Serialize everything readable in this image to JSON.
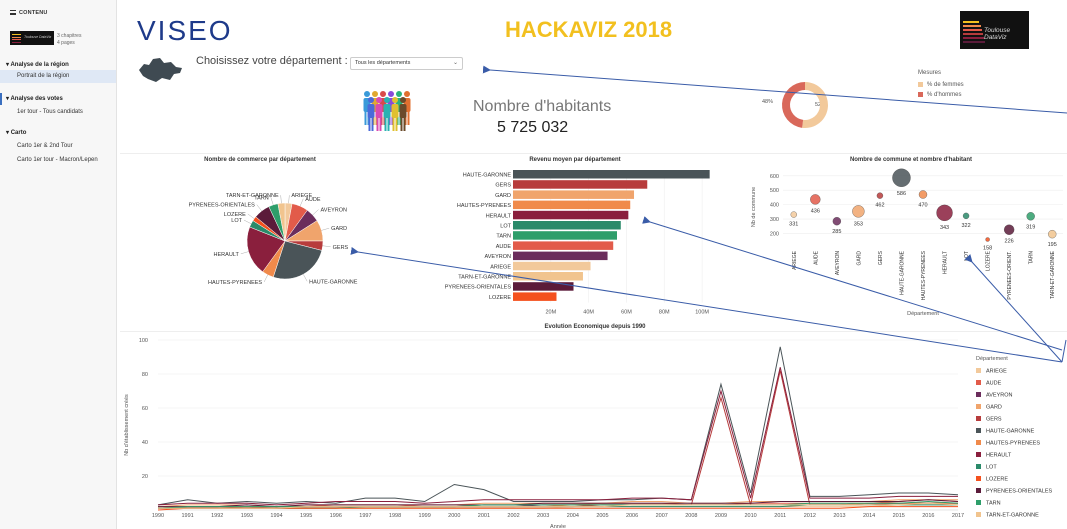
{
  "sidebar": {
    "header": "CONTENU",
    "meta_chapters": "3 chapitres",
    "meta_pages": "4 pages",
    "sections": [
      {
        "label": "Analyse de la région",
        "items": [
          "Portrait de la région"
        ]
      },
      {
        "label": "Analyse des votes",
        "items": [
          "1er tour - Tous candidats"
        ]
      },
      {
        "label": "Carto",
        "items": [
          "Carto 1er & 2nd Tour",
          "Carto 1er tour - Macron/Lepen"
        ]
      }
    ],
    "thumb_text": "Toulouse DataViz"
  },
  "header": {
    "logo": "VISEO",
    "title": "HACKAVIZ 2018",
    "brand_logo_text": "Toulouse DataViz"
  },
  "filter": {
    "label": "Choisissez votre département :",
    "selected": "Tous les départements"
  },
  "kpi": {
    "label": "Nombre d'habitants",
    "value": "5 725 032"
  },
  "colors": {
    "ARIEGE": "#f2c99b",
    "AUDE": "#e25b4a",
    "AVEYRON": "#6b2d5c",
    "GARD": "#f0a46c",
    "GERS": "#b73c3c",
    "HAUTE-GARONNE": "#4a5458",
    "HAUTES-PYRENEES": "#f08a4b",
    "HERAULT": "#8a1f3d",
    "LOT": "#2a8a6a",
    "LOZERE": "#f4511e",
    "PYRENEES-ORIENTALES": "#5b1b3a",
    "TARN": "#2e9e6a",
    "TARN-ET-GARONNE": "#f1c48e"
  },
  "chart_data": [
    {
      "type": "pie",
      "title": "Mesures",
      "legend_title": "Mesures",
      "labels": [
        "% de femmes",
        "% d'hommes"
      ],
      "values": [
        52,
        48
      ],
      "value_labels": [
        "52%",
        "48%"
      ],
      "colors": [
        "#f2c99b",
        "#d9685a"
      ]
    },
    {
      "type": "pie",
      "title": "Nombre de commerce par département",
      "labels": [
        "ARIEGE",
        "AUDE",
        "AVEYRON",
        "GARD",
        "GERS",
        "HAUTE-GARONNE",
        "HAUTES-PYRENEES",
        "HERAULT",
        "LOT",
        "LOZERE",
        "PYRENEES-ORIENTALES",
        "TARN",
        "TARN-ET-GARONNE"
      ],
      "values": [
        3,
        7,
        6,
        9,
        4,
        26,
        5,
        21,
        3,
        2,
        7,
        4,
        3
      ]
    },
    {
      "type": "bar",
      "orientation": "horizontal",
      "title": "Revenu moyen par département",
      "categories": [
        "HAUTE-GARONNE",
        "GERS",
        "GARD",
        "HAUTES-PYRENEES",
        "HERAULT",
        "LOT",
        "TARN",
        "AUDE",
        "AVEYRON",
        "ARIEGE",
        "TARN-ET-GARONNE",
        "PYRENEES-ORIENTALES",
        "LOZERE"
      ],
      "values": [
        104,
        71,
        64,
        62,
        61,
        57,
        55,
        53,
        50,
        41,
        37,
        32,
        23
      ],
      "unit": "M",
      "xticks": [
        "20M",
        "40M",
        "60M",
        "80M",
        "100M"
      ],
      "xlim": [
        0,
        110
      ]
    },
    {
      "type": "scatter",
      "title": "Nombre de commune et nombre d'habitant",
      "xlabel": "Département",
      "ylabel": "Nb de commune",
      "categories": [
        "ARIEGE",
        "AUDE",
        "AVEYRON",
        "GARD",
        "GERS",
        "HAUTE-GARONNE",
        "HAUTES-PYRENEES",
        "HERAULT",
        "LOT",
        "LOZERE",
        "PYRENEES-ORIENT.",
        "TARN",
        "TARN-ET-GARONNE"
      ],
      "values": [
        331,
        436,
        285,
        353,
        462,
        586,
        470,
        343,
        322,
        158,
        226,
        319,
        195
      ],
      "sizes": [
        3,
        5,
        4,
        6,
        3,
        9,
        4,
        8,
        3,
        2,
        5,
        4,
        4
      ],
      "yticks": [
        200,
        300,
        400,
        500,
        600
      ],
      "ylim": [
        120,
        640
      ]
    },
    {
      "type": "line",
      "title": "Evolution Economique depuis 1990",
      "xlabel": "Année",
      "ylabel": "Nb d'établissement créés",
      "legend_title": "Département",
      "x": [
        1990,
        1991,
        1992,
        1993,
        1994,
        1995,
        1996,
        1997,
        1998,
        1999,
        2000,
        2001,
        2002,
        2003,
        2004,
        2005,
        2006,
        2007,
        2008,
        2009,
        2010,
        2011,
        2012,
        2013,
        2014,
        2015,
        2016,
        2017
      ],
      "yticks": [
        20,
        40,
        60,
        80,
        100
      ],
      "ylim": [
        0,
        100
      ],
      "series": [
        {
          "name": "ARIEGE",
          "values": [
            1,
            1,
            1,
            1,
            1,
            1,
            1,
            1,
            1,
            1,
            1,
            1,
            1,
            1,
            2,
            2,
            2,
            2,
            2,
            2,
            2,
            2,
            2,
            2,
            2,
            3,
            3,
            3
          ]
        },
        {
          "name": "AUDE",
          "values": [
            2,
            2,
            2,
            2,
            2,
            2,
            3,
            3,
            3,
            2,
            2,
            3,
            3,
            3,
            3,
            4,
            4,
            4,
            3,
            3,
            4,
            4,
            4,
            4,
            4,
            5,
            6,
            5
          ]
        },
        {
          "name": "AVEYRON",
          "values": [
            1,
            2,
            2,
            2,
            2,
            2,
            2,
            2,
            2,
            2,
            2,
            2,
            2,
            3,
            3,
            3,
            3,
            3,
            3,
            3,
            3,
            3,
            3,
            3,
            4,
            4,
            4,
            4
          ]
        },
        {
          "name": "GARD",
          "values": [
            2,
            3,
            3,
            3,
            2,
            3,
            3,
            3,
            3,
            3,
            3,
            4,
            4,
            4,
            4,
            4,
            5,
            5,
            4,
            4,
            5,
            5,
            5,
            5,
            5,
            6,
            6,
            6
          ]
        },
        {
          "name": "GERS",
          "values": [
            1,
            1,
            1,
            2,
            1,
            2,
            2,
            2,
            2,
            2,
            2,
            2,
            2,
            2,
            2,
            3,
            3,
            3,
            3,
            66,
            3,
            82,
            3,
            3,
            3,
            4,
            4,
            4
          ]
        },
        {
          "name": "HAUTE-GARONNE",
          "values": [
            3,
            6,
            4,
            5,
            4,
            5,
            4,
            7,
            7,
            5,
            15,
            12,
            5,
            5,
            5,
            6,
            6,
            7,
            6,
            74,
            10,
            96,
            8,
            8,
            9,
            10,
            10,
            9
          ]
        },
        {
          "name": "HAUTES-PYRENEES",
          "values": [
            1,
            2,
            2,
            2,
            2,
            2,
            2,
            2,
            2,
            2,
            2,
            2,
            2,
            2,
            3,
            3,
            3,
            3,
            3,
            3,
            3,
            3,
            3,
            3,
            4,
            4,
            4,
            4
          ]
        },
        {
          "name": "HERAULT",
          "values": [
            3,
            4,
            4,
            4,
            3,
            4,
            5,
            5,
            5,
            4,
            5,
            6,
            6,
            6,
            6,
            6,
            7,
            7,
            6,
            70,
            7,
            84,
            7,
            7,
            7,
            8,
            8,
            8
          ]
        },
        {
          "name": "LOT",
          "values": [
            1,
            1,
            1,
            1,
            1,
            1,
            1,
            2,
            2,
            2,
            2,
            2,
            2,
            2,
            2,
            2,
            2,
            2,
            2,
            2,
            2,
            2,
            3,
            3,
            3,
            3,
            3,
            3
          ]
        },
        {
          "name": "LOZERE",
          "values": [
            0,
            1,
            1,
            1,
            1,
            1,
            1,
            1,
            1,
            1,
            1,
            1,
            1,
            1,
            1,
            1,
            1,
            1,
            1,
            1,
            1,
            1,
            1,
            1,
            2,
            2,
            2,
            2
          ]
        },
        {
          "name": "PYRENEES-ORIENTALES",
          "values": [
            2,
            2,
            2,
            3,
            2,
            3,
            3,
            3,
            3,
            3,
            3,
            3,
            3,
            4,
            4,
            4,
            4,
            4,
            4,
            4,
            4,
            5,
            5,
            5,
            5,
            5,
            6,
            5
          ]
        },
        {
          "name": "TARN",
          "values": [
            1,
            2,
            2,
            2,
            2,
            2,
            2,
            2,
            2,
            2,
            2,
            3,
            3,
            3,
            3,
            3,
            3,
            3,
            3,
            3,
            3,
            3,
            4,
            4,
            4,
            4,
            5,
            4
          ]
        },
        {
          "name": "TARN-ET-GARONNE",
          "values": [
            1,
            1,
            1,
            1,
            1,
            2,
            2,
            2,
            2,
            2,
            2,
            2,
            2,
            2,
            2,
            2,
            3,
            3,
            3,
            3,
            3,
            3,
            3,
            3,
            3,
            3,
            4,
            3
          ]
        }
      ]
    }
  ]
}
